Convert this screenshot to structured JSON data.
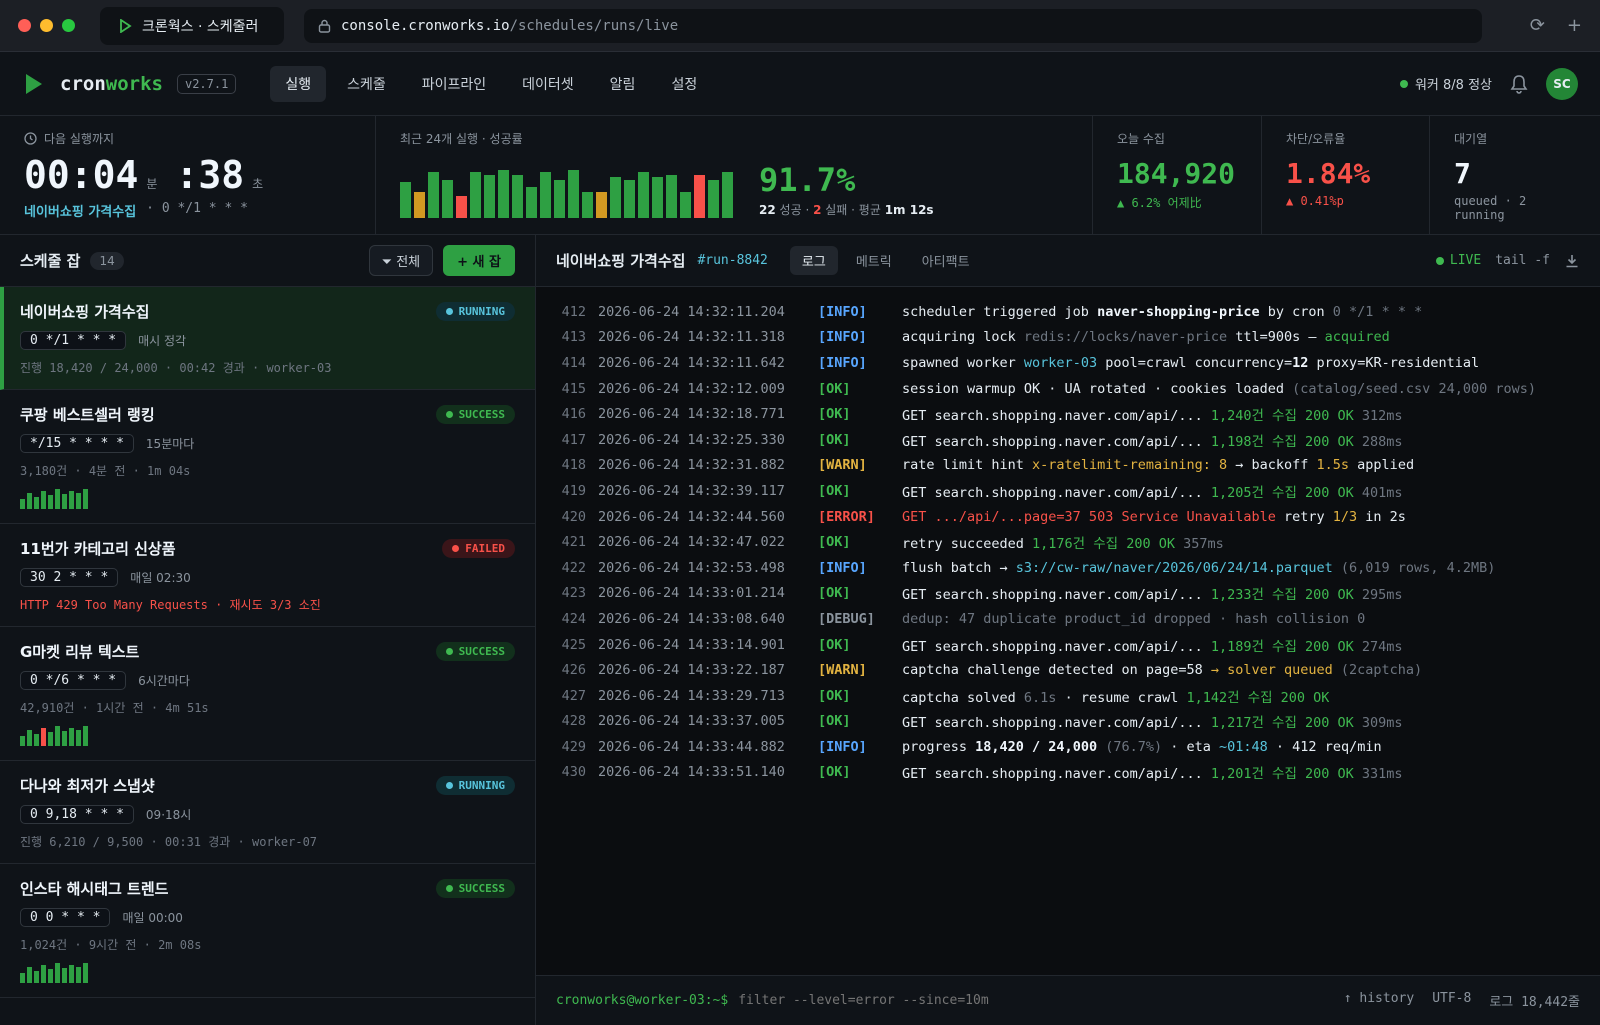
{
  "browser": {
    "tab_title": "크론웍스 · 스케줄러",
    "url_host": "console.cronworks.io",
    "url_path": "/schedules/runs/live"
  },
  "app": {
    "brand_a": "cron",
    "brand_b": "works",
    "version": "v2.7.1",
    "nav": [
      "실행",
      "스케줄",
      "파이프라인",
      "데이터셋",
      "알림",
      "설정"
    ],
    "nav_active": 0,
    "worker_status": "워커 8/8 정상",
    "avatar": "SC"
  },
  "stats": {
    "next_run_label": "다음 실행까지",
    "countdown_min": "00:04",
    "unit_min": "분",
    "countdown_sec": ":38",
    "unit_sec": "초",
    "next_job": "네이버쇼핑 가격수집",
    "next_cron": "· 0 */1 * * *",
    "recent_label": "최근 24개 실행 · 성공률",
    "recent_runs": [
      "ok",
      "warn",
      "ok",
      "ok",
      "fail",
      "ok",
      "ok",
      "ok",
      "ok",
      "ok",
      "ok",
      "ok",
      "ok",
      "ok",
      "warn",
      "ok",
      "ok",
      "ok",
      "ok",
      "ok",
      "ok",
      "fail",
      "ok",
      "ok"
    ],
    "recent_heights": [
      0.75,
      0.55,
      0.95,
      0.8,
      0.45,
      0.95,
      0.9,
      1.0,
      0.9,
      0.65,
      0.95,
      0.8,
      1.0,
      0.55,
      0.55,
      0.85,
      0.8,
      0.95,
      0.85,
      0.9,
      0.55,
      0.9,
      0.8,
      0.95
    ],
    "success_rate": "91.7%",
    "success_count": "22",
    "success_word": "성공",
    "fail_count": "2",
    "fail_word": "실패 · 평균",
    "avg_time": "1m 12s",
    "today_label": "오늘 수집",
    "today_value": "184,920",
    "today_delta": "▲ 6.2% 어제比",
    "block_label": "차단/오류율",
    "block_value": "1.84%",
    "block_delta": "▲ 0.41%p",
    "queue_label": "대기열",
    "queue_value": "7",
    "queue_sub": "queued · 2 running"
  },
  "colors": {
    "ok": "#2ea043",
    "warn": "#d29922",
    "fail": "#f85149",
    "accent": "#58c4dc"
  },
  "jobs_panel": {
    "title": "스케줄 잡",
    "count": "14",
    "filter_label": "전체",
    "new_label": "+ 새 잡"
  },
  "jobs": [
    {
      "name": "네이버쇼핑 가격수집",
      "status": "RUNNING",
      "cron": "0 */1 * * *",
      "desc": "매시 정각",
      "meta": "진행 18,420 / 24,000 · 00:42 경과 · worker-03",
      "spark": []
    },
    {
      "name": "쿠팡 베스트셀러 랭킹",
      "status": "SUCCESS",
      "cron": "*/15 * * * *",
      "desc": "15분마다",
      "meta": "3,180건 · 4분 전 · 1m 04s",
      "spark": [
        "ok",
        "ok",
        "ok",
        "ok",
        "ok",
        "ok",
        "ok",
        "ok",
        "ok",
        "ok"
      ]
    },
    {
      "name": "11번가 카테고리 신상품",
      "status": "FAILED",
      "cron": "30 2 * * *",
      "desc": "매일 02:30",
      "meta": "HTTP 429 Too Many Requests · 재시도 3/3 소진",
      "spark": []
    },
    {
      "name": "G마켓 리뷰 텍스트",
      "status": "SUCCESS",
      "cron": "0 */6 * * *",
      "desc": "6시간마다",
      "meta": "42,910건 · 1시간 전 · 4m 51s",
      "spark": [
        "ok",
        "ok",
        "ok",
        "fail",
        "ok",
        "ok",
        "ok",
        "ok",
        "ok",
        "ok"
      ]
    },
    {
      "name": "다나와 최저가 스냅샷",
      "status": "RUNNING",
      "cron": "0 9,18 * * *",
      "desc": "09·18시",
      "meta": "진행 6,210 / 9,500 · 00:31 경과 · worker-07",
      "spark": []
    },
    {
      "name": "인스타 해시태그 트렌드",
      "status": "SUCCESS",
      "cron": "0 0 * * *",
      "desc": "매일 00:00",
      "meta": "1,024건 · 9시간 전 · 2m 08s",
      "spark": [
        "ok",
        "ok",
        "ok",
        "ok",
        "ok",
        "ok",
        "ok",
        "ok",
        "ok",
        "ok"
      ]
    }
  ],
  "spark_heights": [
    0.5,
    0.8,
    0.6,
    0.9,
    0.7,
    1.0,
    0.75,
    0.9,
    0.8,
    1.0
  ],
  "log_panel": {
    "title": "네이버쇼핑 가격수집",
    "run_id": "#run-8842",
    "tabs": [
      "로그",
      "메트릭",
      "아티팩트"
    ],
    "live": "LIVE",
    "tail": "tail -f"
  },
  "logs": [
    {
      "n": "412",
      "ts": "2026-06-24 14:32:11.204",
      "lvl": "INFO",
      "parts": [
        [
          "scheduler triggered job ",
          ""
        ],
        [
          "naver-shopping-price",
          "c-wht"
        ],
        [
          " by cron ",
          ""
        ],
        [
          "0 */1 * * *",
          "c-dim"
        ]
      ]
    },
    {
      "n": "413",
      "ts": "2026-06-24 14:32:11.318",
      "lvl": "INFO",
      "parts": [
        [
          "acquiring lock ",
          ""
        ],
        [
          "redis://locks/naver-price",
          "c-dim"
        ],
        [
          " ttl=900s — ",
          ""
        ],
        [
          "acquired",
          "c-grn"
        ]
      ]
    },
    {
      "n": "414",
      "ts": "2026-06-24 14:32:11.642",
      "lvl": "INFO",
      "parts": [
        [
          "spawned worker ",
          ""
        ],
        [
          "worker-03",
          "c-cyan"
        ],
        [
          " pool=crawl concurrency=",
          ""
        ],
        [
          "12",
          "c-wht"
        ],
        [
          " proxy=KR-residential",
          ""
        ]
      ]
    },
    {
      "n": "415",
      "ts": "2026-06-24 14:32:12.009",
      "lvl": "OK",
      "parts": [
        [
          "session warmup OK · UA rotated · cookies loaded ",
          ""
        ],
        [
          "(catalog/seed.csv 24,000 rows)",
          "c-dim"
        ]
      ]
    },
    {
      "n": "416",
      "ts": "2026-06-24 14:32:18.771",
      "lvl": "OK",
      "parts": [
        [
          "GET search.shopping.naver.com/api/... ",
          ""
        ],
        [
          "1,240건 수집 200 OK",
          "c-grn"
        ],
        [
          " 312ms",
          "c-dim"
        ]
      ]
    },
    {
      "n": "417",
      "ts": "2026-06-24 14:32:25.330",
      "lvl": "OK",
      "parts": [
        [
          "GET search.shopping.naver.com/api/... ",
          ""
        ],
        [
          "1,198건 수집 200 OK",
          "c-grn"
        ],
        [
          " 288ms",
          "c-dim"
        ]
      ]
    },
    {
      "n": "418",
      "ts": "2026-06-24 14:32:31.882",
      "lvl": "WARN",
      "parts": [
        [
          "rate limit hint ",
          ""
        ],
        [
          "x-ratelimit-remaining: 8",
          "c-yel"
        ],
        [
          " → backoff ",
          ""
        ],
        [
          "1.5s",
          "c-yel"
        ],
        [
          " applied",
          ""
        ]
      ]
    },
    {
      "n": "419",
      "ts": "2026-06-24 14:32:39.117",
      "lvl": "OK",
      "parts": [
        [
          "GET search.shopping.naver.com/api/... ",
          ""
        ],
        [
          "1,205건 수집 200 OK",
          "c-grn"
        ],
        [
          " 401ms",
          "c-dim"
        ]
      ]
    },
    {
      "n": "420",
      "ts": "2026-06-24 14:32:44.560",
      "lvl": "ERROR",
      "parts": [
        [
          "GET .../api/...page=37 503 Service Unavailable",
          "c-red"
        ],
        [
          " retry ",
          ""
        ],
        [
          "1/3",
          "c-yel"
        ],
        [
          " in 2s",
          ""
        ]
      ]
    },
    {
      "n": "421",
      "ts": "2026-06-24 14:32:47.022",
      "lvl": "OK",
      "parts": [
        [
          "retry succeeded ",
          ""
        ],
        [
          "1,176건 수집 200 OK",
          "c-grn"
        ],
        [
          " 357ms",
          "c-dim"
        ]
      ]
    },
    {
      "n": "422",
      "ts": "2026-06-24 14:32:53.498",
      "lvl": "INFO",
      "parts": [
        [
          "flush batch → ",
          ""
        ],
        [
          "s3://cw-raw/naver/2026/06/24/14.parquet",
          "c-cyan"
        ],
        [
          " (6,019 rows, 4.2MB)",
          "c-dim"
        ]
      ]
    },
    {
      "n": "423",
      "ts": "2026-06-24 14:33:01.214",
      "lvl": "OK",
      "parts": [
        [
          "GET search.shopping.naver.com/api/... ",
          ""
        ],
        [
          "1,233건 수집 200 OK",
          "c-grn"
        ],
        [
          " 295ms",
          "c-dim"
        ]
      ]
    },
    {
      "n": "424",
      "ts": "2026-06-24 14:33:08.640",
      "lvl": "DEBUG",
      "parts": [
        [
          "dedup: 47 duplicate product_id dropped · hash collision 0",
          "c-dim"
        ]
      ]
    },
    {
      "n": "425",
      "ts": "2026-06-24 14:33:14.901",
      "lvl": "OK",
      "parts": [
        [
          "GET search.shopping.naver.com/api/... ",
          ""
        ],
        [
          "1,189건 수집 200 OK",
          "c-grn"
        ],
        [
          " 274ms",
          "c-dim"
        ]
      ]
    },
    {
      "n": "426",
      "ts": "2026-06-24 14:33:22.187",
      "lvl": "WARN",
      "parts": [
        [
          "captcha challenge detected on page=58 ",
          ""
        ],
        [
          "→ solver queued",
          "c-orn"
        ],
        [
          " (2captcha)",
          "c-dim"
        ]
      ]
    },
    {
      "n": "427",
      "ts": "2026-06-24 14:33:29.713",
      "lvl": "OK",
      "parts": [
        [
          "captcha solved ",
          ""
        ],
        [
          "6.1s",
          "c-dim"
        ],
        [
          " · resume crawl ",
          ""
        ],
        [
          "1,142건 수집 200 OK",
          "c-grn"
        ]
      ]
    },
    {
      "n": "428",
      "ts": "2026-06-24 14:33:37.005",
      "lvl": "OK",
      "parts": [
        [
          "GET search.shopping.naver.com/api/... ",
          ""
        ],
        [
          "1,217건 수집 200 OK",
          "c-grn"
        ],
        [
          " 309ms",
          "c-dim"
        ]
      ]
    },
    {
      "n": "429",
      "ts": "2026-06-24 14:33:44.882",
      "lvl": "INFO",
      "parts": [
        [
          "progress ",
          ""
        ],
        [
          "18,420 / 24,000",
          "c-wht"
        ],
        [
          " (76.7%)",
          "c-dim"
        ],
        [
          " · eta ",
          ""
        ],
        [
          "~01:48",
          "c-cyan"
        ],
        [
          " · 412 req/min",
          ""
        ]
      ]
    },
    {
      "n": "430",
      "ts": "2026-06-24 14:33:51.140",
      "lvl": "OK",
      "parts": [
        [
          "GET search.shopping.naver.com/api/... ",
          ""
        ],
        [
          "1,201건 수집 200 OK",
          "c-grn"
        ],
        [
          " 331ms",
          "c-dim"
        ]
      ]
    }
  ],
  "console": {
    "prompt": "cronworks@worker-03:~$",
    "placeholder": "filter --level=error --since=10m",
    "history": "↑ history",
    "encoding": "UTF-8",
    "log_count": "로그 18,442줄"
  }
}
